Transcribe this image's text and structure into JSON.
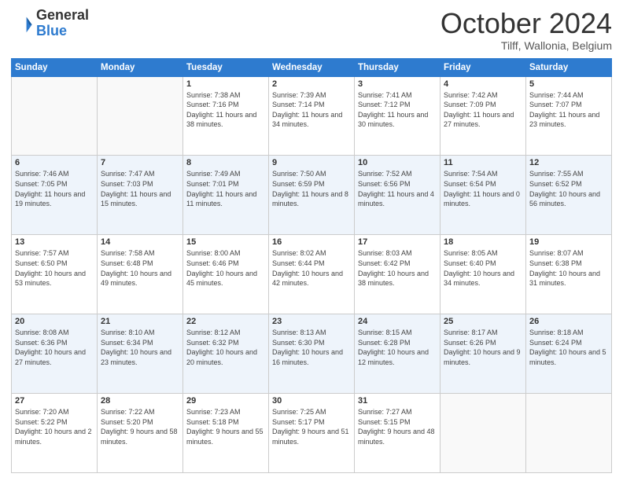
{
  "header": {
    "logo_text_general": "General",
    "logo_text_blue": "Blue",
    "month_title": "October 2024",
    "location": "Tilff, Wallonia, Belgium"
  },
  "days_of_week": [
    "Sunday",
    "Monday",
    "Tuesday",
    "Wednesday",
    "Thursday",
    "Friday",
    "Saturday"
  ],
  "weeks": [
    [
      {
        "day": "",
        "empty": true
      },
      {
        "day": "",
        "empty": true
      },
      {
        "day": "1",
        "sunrise": "7:38 AM",
        "sunset": "7:16 PM",
        "daylight": "11 hours and 38 minutes."
      },
      {
        "day": "2",
        "sunrise": "7:39 AM",
        "sunset": "7:14 PM",
        "daylight": "11 hours and 34 minutes."
      },
      {
        "day": "3",
        "sunrise": "7:41 AM",
        "sunset": "7:12 PM",
        "daylight": "11 hours and 30 minutes."
      },
      {
        "day": "4",
        "sunrise": "7:42 AM",
        "sunset": "7:09 PM",
        "daylight": "11 hours and 27 minutes."
      },
      {
        "day": "5",
        "sunrise": "7:44 AM",
        "sunset": "7:07 PM",
        "daylight": "11 hours and 23 minutes."
      }
    ],
    [
      {
        "day": "6",
        "sunrise": "7:46 AM",
        "sunset": "7:05 PM",
        "daylight": "11 hours and 19 minutes."
      },
      {
        "day": "7",
        "sunrise": "7:47 AM",
        "sunset": "7:03 PM",
        "daylight": "11 hours and 15 minutes."
      },
      {
        "day": "8",
        "sunrise": "7:49 AM",
        "sunset": "7:01 PM",
        "daylight": "11 hours and 11 minutes."
      },
      {
        "day": "9",
        "sunrise": "7:50 AM",
        "sunset": "6:59 PM",
        "daylight": "11 hours and 8 minutes."
      },
      {
        "day": "10",
        "sunrise": "7:52 AM",
        "sunset": "6:56 PM",
        "daylight": "11 hours and 4 minutes."
      },
      {
        "day": "11",
        "sunrise": "7:54 AM",
        "sunset": "6:54 PM",
        "daylight": "11 hours and 0 minutes."
      },
      {
        "day": "12",
        "sunrise": "7:55 AM",
        "sunset": "6:52 PM",
        "daylight": "10 hours and 56 minutes."
      }
    ],
    [
      {
        "day": "13",
        "sunrise": "7:57 AM",
        "sunset": "6:50 PM",
        "daylight": "10 hours and 53 minutes."
      },
      {
        "day": "14",
        "sunrise": "7:58 AM",
        "sunset": "6:48 PM",
        "daylight": "10 hours and 49 minutes."
      },
      {
        "day": "15",
        "sunrise": "8:00 AM",
        "sunset": "6:46 PM",
        "daylight": "10 hours and 45 minutes."
      },
      {
        "day": "16",
        "sunrise": "8:02 AM",
        "sunset": "6:44 PM",
        "daylight": "10 hours and 42 minutes."
      },
      {
        "day": "17",
        "sunrise": "8:03 AM",
        "sunset": "6:42 PM",
        "daylight": "10 hours and 38 minutes."
      },
      {
        "day": "18",
        "sunrise": "8:05 AM",
        "sunset": "6:40 PM",
        "daylight": "10 hours and 34 minutes."
      },
      {
        "day": "19",
        "sunrise": "8:07 AM",
        "sunset": "6:38 PM",
        "daylight": "10 hours and 31 minutes."
      }
    ],
    [
      {
        "day": "20",
        "sunrise": "8:08 AM",
        "sunset": "6:36 PM",
        "daylight": "10 hours and 27 minutes."
      },
      {
        "day": "21",
        "sunrise": "8:10 AM",
        "sunset": "6:34 PM",
        "daylight": "10 hours and 23 minutes."
      },
      {
        "day": "22",
        "sunrise": "8:12 AM",
        "sunset": "6:32 PM",
        "daylight": "10 hours and 20 minutes."
      },
      {
        "day": "23",
        "sunrise": "8:13 AM",
        "sunset": "6:30 PM",
        "daylight": "10 hours and 16 minutes."
      },
      {
        "day": "24",
        "sunrise": "8:15 AM",
        "sunset": "6:28 PM",
        "daylight": "10 hours and 12 minutes."
      },
      {
        "day": "25",
        "sunrise": "8:17 AM",
        "sunset": "6:26 PM",
        "daylight": "10 hours and 9 minutes."
      },
      {
        "day": "26",
        "sunrise": "8:18 AM",
        "sunset": "6:24 PM",
        "daylight": "10 hours and 5 minutes."
      }
    ],
    [
      {
        "day": "27",
        "sunrise": "7:20 AM",
        "sunset": "5:22 PM",
        "daylight": "10 hours and 2 minutes."
      },
      {
        "day": "28",
        "sunrise": "7:22 AM",
        "sunset": "5:20 PM",
        "daylight": "9 hours and 58 minutes."
      },
      {
        "day": "29",
        "sunrise": "7:23 AM",
        "sunset": "5:18 PM",
        "daylight": "9 hours and 55 minutes."
      },
      {
        "day": "30",
        "sunrise": "7:25 AM",
        "sunset": "5:17 PM",
        "daylight": "9 hours and 51 minutes."
      },
      {
        "day": "31",
        "sunrise": "7:27 AM",
        "sunset": "5:15 PM",
        "daylight": "9 hours and 48 minutes."
      },
      {
        "day": "",
        "empty": true
      },
      {
        "day": "",
        "empty": true
      }
    ]
  ]
}
